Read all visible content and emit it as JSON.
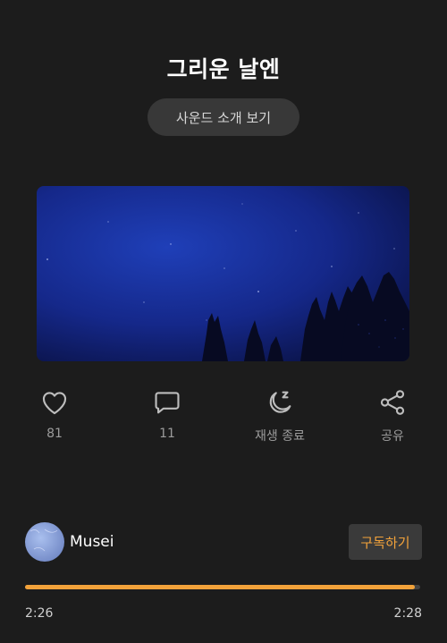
{
  "header": {
    "title": "그리운 날엔",
    "intro_button_label": "사운드 소개 보기"
  },
  "actions": [
    {
      "name": "like",
      "icon": "heart-icon",
      "label": "81"
    },
    {
      "name": "comment",
      "icon": "comment-icon",
      "label": "11"
    },
    {
      "name": "sleep-timer",
      "icon": "moon-icon",
      "label": "재생 종료"
    },
    {
      "name": "share",
      "icon": "share-icon",
      "label": "공유"
    }
  ],
  "channel": {
    "name": "Musei",
    "subscribe_label": "구독하기"
  },
  "player": {
    "current_time": "2:26",
    "total_time": "2:28",
    "progress_fraction": 0.986
  },
  "colors": {
    "background": "#1c1c1c",
    "accent": "#f2a23a",
    "secondary_text": "#9c9c9c"
  }
}
